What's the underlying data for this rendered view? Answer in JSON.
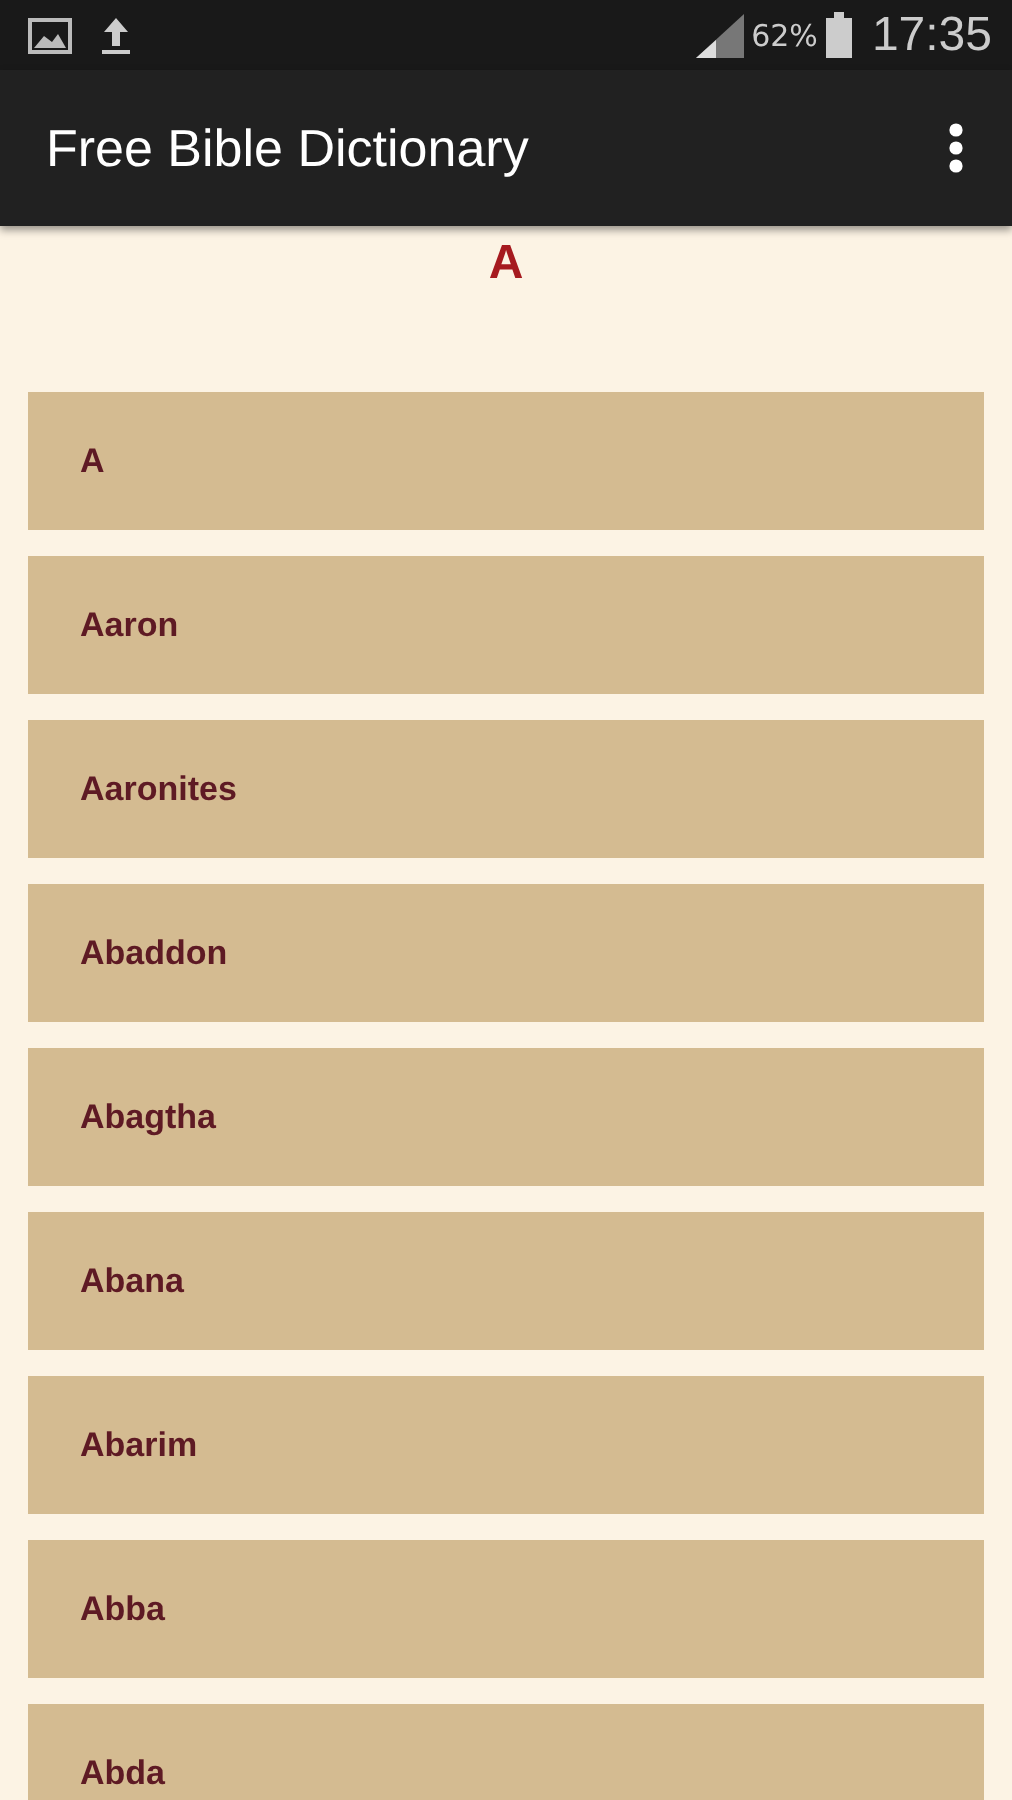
{
  "status_bar": {
    "battery_text": "62%",
    "time": "17:35"
  },
  "app_bar": {
    "title": "Free Bible Dictionary"
  },
  "section_heading": "A",
  "entries": [
    {
      "label": "A"
    },
    {
      "label": "Aaron"
    },
    {
      "label": "Aaronites"
    },
    {
      "label": "Abaddon"
    },
    {
      "label": "Abagtha"
    },
    {
      "label": "Abana"
    },
    {
      "label": "Abarim"
    },
    {
      "label": "Abba"
    },
    {
      "label": "Abda"
    }
  ]
}
